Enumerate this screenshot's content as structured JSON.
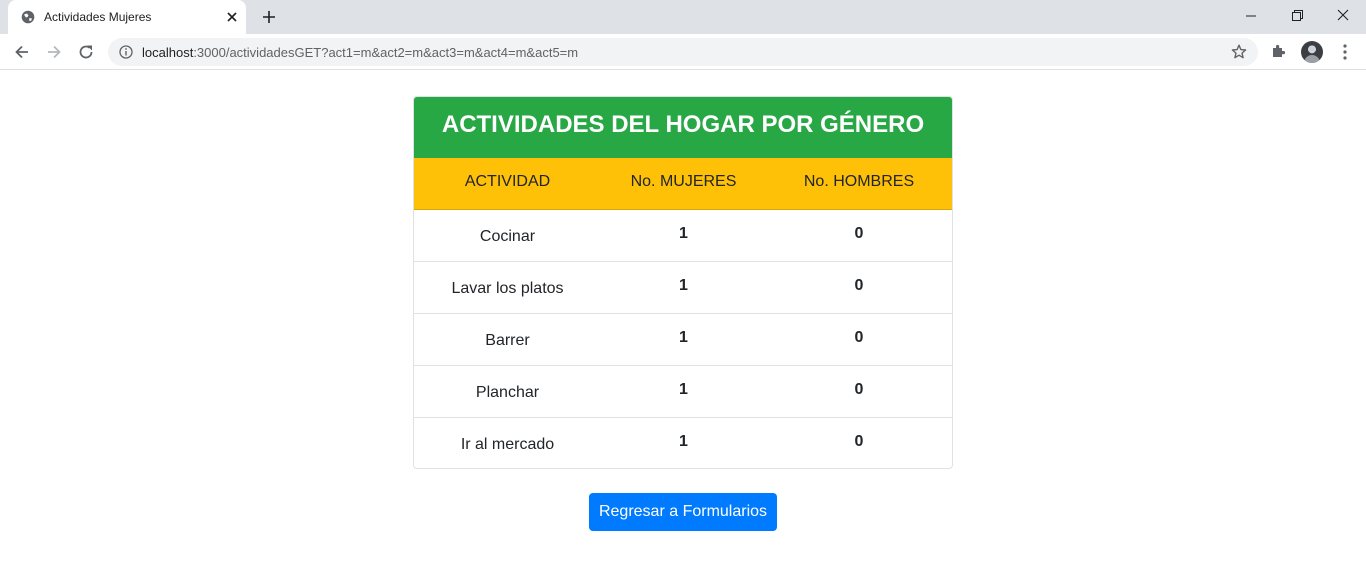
{
  "browser": {
    "tab_title": "Actividades Mujeres",
    "url_host": "localhost",
    "url_rest": ":3000/actividadesGET?act1=m&act2=m&act3=m&act4=m&act5=m",
    "icons": [
      "globe-icon",
      "close-icon",
      "plus-icon",
      "minimize-icon",
      "restore-icon",
      "close-window-icon",
      "back-icon",
      "forward-icon",
      "reload-icon",
      "info-icon",
      "star-icon",
      "puzzle-icon",
      "avatar",
      "kebab-menu-icon"
    ]
  },
  "table": {
    "title": "ACTIVIDADES DEL HOGAR POR GÉNERO",
    "headers": [
      "ACTIVIDAD",
      "No. MUJERES",
      "No. HOMBRES"
    ],
    "rows": [
      {
        "activity": "Cocinar",
        "women": "1",
        "men": "0"
      },
      {
        "activity": "Lavar los platos",
        "women": "1",
        "men": "0"
      },
      {
        "activity": "Barrer",
        "women": "1",
        "men": "0"
      },
      {
        "activity": "Planchar",
        "women": "1",
        "men": "0"
      },
      {
        "activity": "Ir al mercado",
        "women": "1",
        "men": "0"
      }
    ]
  },
  "back_button": {
    "label": "Regresar a Formularios"
  },
  "colors": {
    "header_green": "#28a745",
    "header_yellow": "#ffc107",
    "button_blue": "#007bff"
  }
}
